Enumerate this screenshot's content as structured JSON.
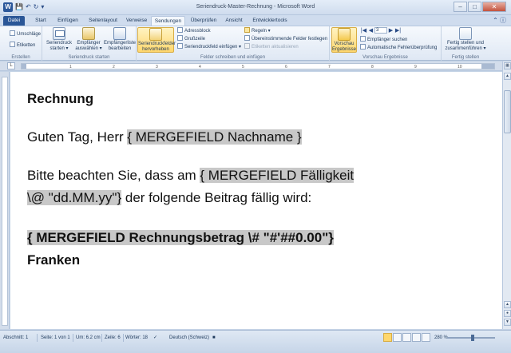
{
  "window": {
    "title": "Seriendruck-Master-Rechnung  -  Microsoft Word",
    "app_icon": "W",
    "quick_access": [
      "save-icon",
      "undo-icon",
      "redo-icon",
      "customize-icon"
    ]
  },
  "tabs": [
    "Datei",
    "Start",
    "Einfügen",
    "Seitenlayout",
    "Verweise",
    "Sendungen",
    "Überprüfen",
    "Ansicht",
    "Entwicklertools"
  ],
  "active_tab": "Sendungen",
  "ribbon": {
    "erstellen": {
      "label": "Erstellen",
      "umschlaege": "Umschläge",
      "etiketten": "Etiketten"
    },
    "seriendruck_starten": {
      "label": "Seriendruck starten",
      "starten": "Seriendruck starten ▾",
      "empfaenger": "Empfänger auswählen ▾",
      "liste": "Empfängerliste bearbeiten"
    },
    "felder": {
      "label": "Felder schreiben und einfügen",
      "hervorheben": "Seriendruckfelder hervorheben",
      "adressblock": "Adressblock",
      "grusszeile": "Grußzeile",
      "feld_einfuegen": "Seriendruckfeld einfügen ▾",
      "regeln": "Regeln ▾",
      "uebereinstimmende": "Übereinstimmende Felder festlegen",
      "etiketten_aktualisieren": "Etiketten aktualisieren"
    },
    "vorschau": {
      "label": "Vorschau Ergebnisse",
      "vorschau_btn": "Vorschau Ergebnisse",
      "record": "3",
      "empfaenger_suchen": "Empfänger suchen",
      "fehlerueberpruefung": "Automatische Fehlerüberprüfung"
    },
    "fertig": {
      "label": "Fertig stellen",
      "fertig_btn": "Fertig stellen und zusammenführen ▾"
    }
  },
  "ruler_ticks": [
    "1",
    "2",
    "3",
    "4",
    "5",
    "6",
    "7",
    "8",
    "9",
    "10"
  ],
  "document": {
    "heading": "Rechnung",
    "greeting_prefix": "Guten Tag, Herr ",
    "greeting_field": "{ MERGEFIELD Nachname }",
    "para_prefix": "Bitte beachten Sie, dass am ",
    "para_field_1": "{ MERGEFIELD Fälligkeit",
    "para_field_2": "\\@ \"dd.MM.yy\"}",
    "para_suffix": " der folgende Beitrag fällig wird:",
    "amount_field": "{ MERGEFIELD Rechnungsbetrag \\# \"#'##0.00\"}",
    "currency": "Franken"
  },
  "status": {
    "abschnitt": "Abschnitt: 1",
    "seite": "Seite: 1 von 1",
    "um": "Um: 6.2 cm",
    "zeile": "Zeile: 6",
    "woerter": "Wörter: 18",
    "sprache": "Deutsch (Schweiz)",
    "zoom": "280 %"
  }
}
